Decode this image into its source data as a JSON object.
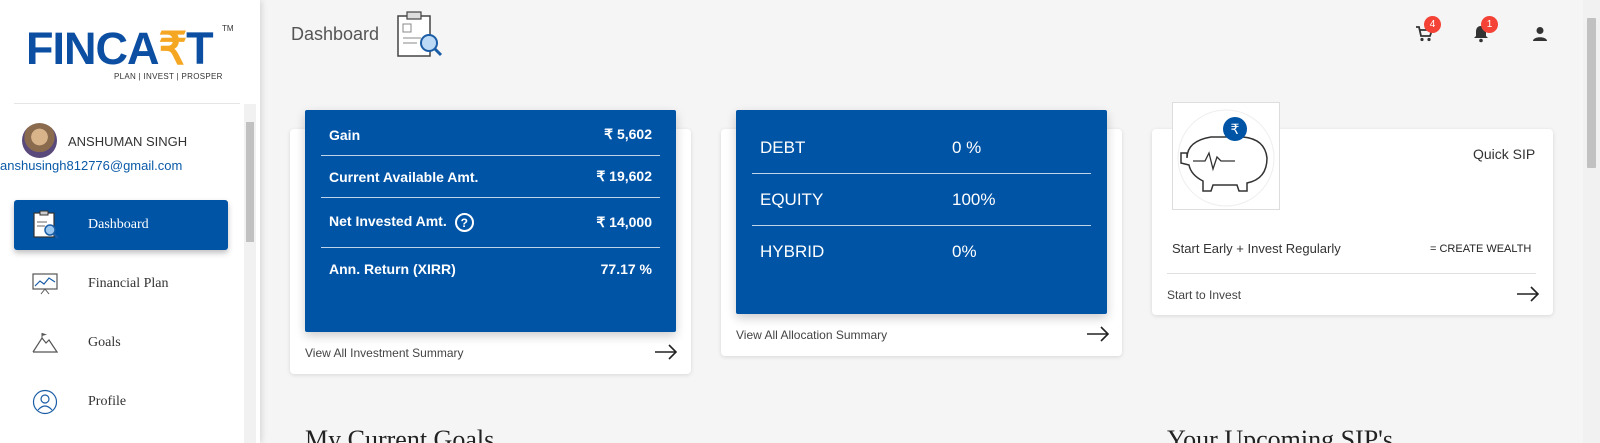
{
  "brand": {
    "name_part1": "FINCA",
    "name_rupee": "₹",
    "name_part2": "T",
    "trademark": "TM",
    "tagline": "PLAN | INVEST | PROSPER",
    "primary_color": "#0054a6",
    "accent_color": "#f5a623"
  },
  "user": {
    "name": "ANSHUMAN SINGH",
    "email": "anshusingh812776@gmail.com"
  },
  "sidebar": {
    "items": [
      {
        "label": "Dashboard",
        "icon": "dashboard-icon",
        "active": true
      },
      {
        "label": "Financial Plan",
        "icon": "chart-icon",
        "active": false
      },
      {
        "label": "Goals",
        "icon": "mountain-flag-icon",
        "active": false
      },
      {
        "label": "Profile",
        "icon": "user-circle-icon",
        "active": false
      }
    ]
  },
  "header": {
    "title": "Dashboard",
    "cart_badge": "4",
    "notification_badge": "1",
    "badge_color": "#f44336"
  },
  "investment": {
    "rows": [
      {
        "label": "Gain",
        "value": "₹ 5,602"
      },
      {
        "label": "Current Available Amt.",
        "value": "₹ 19,602"
      },
      {
        "label": "Net Invested Amt.",
        "value": "₹ 14,000"
      },
      {
        "label": "Ann. Return (XIRR)",
        "value": "77.17 %"
      }
    ],
    "help_symbol": "?",
    "link": "View All Investment Summary"
  },
  "allocation": {
    "rows": [
      {
        "label": "DEBT",
        "value": "0 %"
      },
      {
        "label": "EQUITY",
        "value": "100%"
      },
      {
        "label": "HYBRID",
        "value": "0%"
      }
    ],
    "link": "View All Allocation Summary"
  },
  "quick_sip": {
    "title": "Quick SIP",
    "tagline": "Start Early + Invest Regularly",
    "wealth": "= CREATE WEALTH",
    "link": "Start to Invest",
    "coin_symbol": "₹"
  },
  "sections": {
    "goals_title": "My Current Goals",
    "sip_title": "Your Upcoming SIP's"
  }
}
